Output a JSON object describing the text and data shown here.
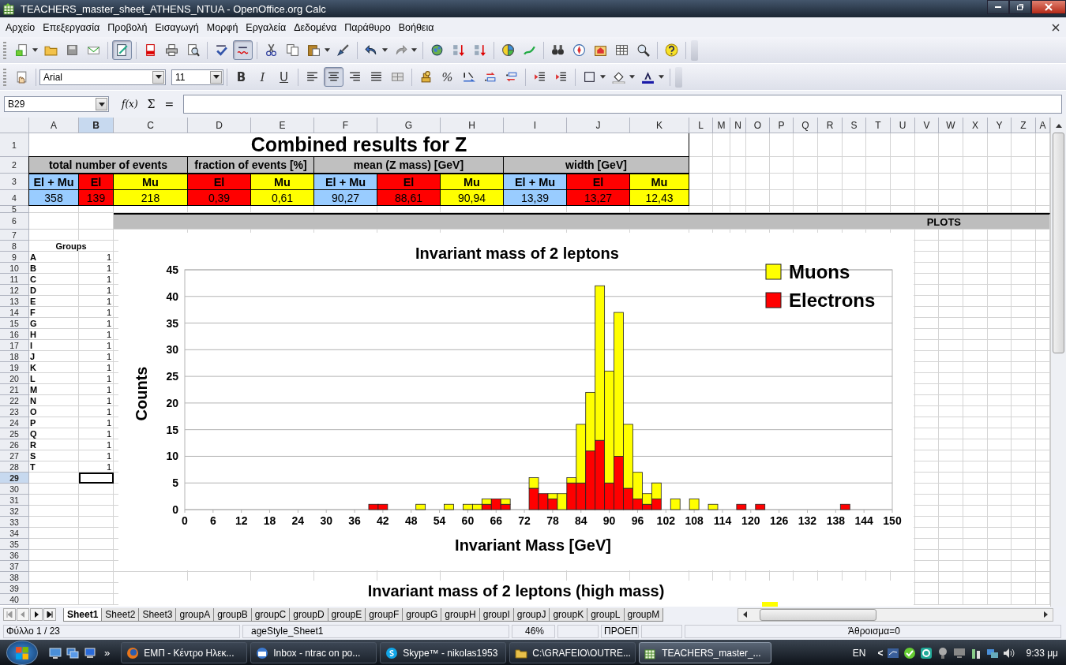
{
  "window": {
    "title": "TEACHERS_master_sheet_ATHENS_NTUA - OpenOffice.org Calc"
  },
  "menu": [
    "Αρχείο",
    "Επεξεργασία",
    "Προβολή",
    "Εισαγωγή",
    "Μορφή",
    "Εργαλεία",
    "Δεδομένα",
    "Παράθυρο",
    "Βοήθεια"
  ],
  "standard_toolbar": [
    [
      {
        "pressed": false
      },
      {
        "pressed": false
      },
      {
        "pressed": false
      },
      {
        "pressed": false
      }
    ],
    [
      {
        "pressed": true
      }
    ],
    [
      {
        "pressed": false
      },
      {
        "pressed": false
      },
      {
        "pressed": false
      }
    ],
    [
      {
        "pressed": false
      },
      {
        "pressed": true
      }
    ],
    [
      {
        "pressed": false
      },
      {
        "pressed": false
      },
      {
        "pressed": false
      },
      {
        "pressed": false
      }
    ],
    [
      {
        "pressed": false
      },
      {
        "pressed": false
      }
    ],
    [
      {
        "pressed": false
      },
      {
        "pressed": false
      },
      {
        "pressed": false
      }
    ],
    [
      {
        "pressed": false
      },
      {
        "pressed": false
      }
    ],
    [
      {
        "pressed": false
      },
      {
        "pressed": false
      },
      {
        "pressed": false
      },
      {
        "pressed": false
      },
      {
        "pressed": false
      }
    ],
    [
      {
        "pressed": false
      }
    ]
  ],
  "formatting_toolbar": {
    "font": "Arial",
    "size": "11",
    "groups": [
      [
        {
          "label": "B",
          "pressed": false
        },
        {
          "label": "I",
          "pressed": false
        },
        {
          "label": "U",
          "pressed": false
        }
      ],
      [
        {
          "pressed": false
        },
        {
          "pressed": true
        },
        {
          "pressed": false
        },
        {
          "pressed": false
        },
        {
          "pressed": false
        }
      ],
      [
        {
          "pressed": false
        },
        {
          "label": "%",
          "pressed": false
        },
        {
          "pressed": false
        },
        {
          "pressed": false
        },
        {
          "pressed": false
        }
      ],
      [
        {
          "pressed": false
        },
        {
          "pressed": false
        }
      ],
      [
        {
          "pressed": false
        },
        {
          "pressed": false
        },
        {
          "pressed": false
        }
      ]
    ]
  },
  "formula_bar": {
    "name_box": "B29",
    "function_wizard": "f(x)",
    "sum_button": "Σ",
    "equals_button": "="
  },
  "columns": [
    {
      "label": "A",
      "selected": false
    },
    {
      "label": "B",
      "selected": true
    },
    {
      "label": "C",
      "selected": false
    },
    {
      "label": "D",
      "selected": false
    },
    {
      "label": "E",
      "selected": false
    },
    {
      "label": "F",
      "selected": false
    },
    {
      "label": "G",
      "selected": false
    },
    {
      "label": "H",
      "selected": false
    },
    {
      "label": "I",
      "selected": false
    },
    {
      "label": "J",
      "selected": false
    },
    {
      "label": "K",
      "selected": false
    },
    {
      "label": "L",
      "selected": false
    },
    {
      "label": "M",
      "selected": false
    },
    {
      "label": "N",
      "selected": false
    },
    {
      "label": "O",
      "selected": false
    },
    {
      "label": "P",
      "selected": false
    },
    {
      "label": "Q",
      "selected": false
    },
    {
      "label": "R",
      "selected": false
    },
    {
      "label": "S",
      "selected": false
    },
    {
      "label": "T",
      "selected": false
    },
    {
      "label": "U",
      "selected": false
    },
    {
      "label": "V",
      "selected": false
    },
    {
      "label": "W",
      "selected": false
    },
    {
      "label": "X",
      "selected": false
    },
    {
      "label": "Y",
      "selected": false
    },
    {
      "label": "Z",
      "selected": false
    },
    {
      "label": "A",
      "selected": false
    }
  ],
  "rows": [
    {
      "label": "1",
      "selected": false
    },
    {
      "label": "2",
      "selected": false
    },
    {
      "label": "3",
      "selected": false
    },
    {
      "label": "4",
      "selected": false
    },
    {
      "label": "5",
      "selected": false
    },
    {
      "label": "6",
      "selected": false
    },
    {
      "label": "7",
      "selected": false
    },
    {
      "label": "8",
      "selected": false
    },
    {
      "label": "9",
      "selected": false
    },
    {
      "label": "10",
      "selected": false
    },
    {
      "label": "11",
      "selected": false
    },
    {
      "label": "12",
      "selected": false
    },
    {
      "label": "13",
      "selected": false
    },
    {
      "label": "14",
      "selected": false
    },
    {
      "label": "15",
      "selected": false
    },
    {
      "label": "16",
      "selected": false
    },
    {
      "label": "17",
      "selected": false
    },
    {
      "label": "18",
      "selected": false
    },
    {
      "label": "19",
      "selected": false
    },
    {
      "label": "20",
      "selected": false
    },
    {
      "label": "21",
      "selected": false
    },
    {
      "label": "22",
      "selected": false
    },
    {
      "label": "23",
      "selected": false
    },
    {
      "label": "24",
      "selected": false
    },
    {
      "label": "25",
      "selected": false
    },
    {
      "label": "26",
      "selected": false
    },
    {
      "label": "27",
      "selected": false
    },
    {
      "label": "28",
      "selected": false
    },
    {
      "label": "29",
      "selected": true
    },
    {
      "label": "30",
      "selected": false
    },
    {
      "label": "31",
      "selected": false
    },
    {
      "label": "32",
      "selected": false
    },
    {
      "label": "33",
      "selected": false
    },
    {
      "label": "34",
      "selected": false
    },
    {
      "label": "35",
      "selected": false
    },
    {
      "label": "36",
      "selected": false
    },
    {
      "label": "37",
      "selected": false
    },
    {
      "label": "38",
      "selected": false
    },
    {
      "label": "39",
      "selected": false
    },
    {
      "label": "40",
      "selected": false
    }
  ],
  "summary": {
    "title": "Combined results for Z",
    "groups": [
      {
        "label": "total number of events",
        "cells": [
          {
            "header": "El + Mu",
            "value": "358",
            "color": "#99ccff"
          },
          {
            "header": "El",
            "value": "139",
            "color": "#ff0000"
          },
          {
            "header": "Mu",
            "value": "218",
            "color": "#ffff00"
          }
        ]
      },
      {
        "label": "fraction of events [%]",
        "cells": [
          {
            "header": "El",
            "value": "0,39",
            "color": "#ff0000"
          },
          {
            "header": "Mu",
            "value": "0,61",
            "color": "#ffff00"
          }
        ]
      },
      {
        "label": "mean (Z mass) [GeV]",
        "cells": [
          {
            "header": "El + Mu",
            "value": "90,27",
            "color": "#99ccff"
          },
          {
            "header": "El",
            "value": "88,61",
            "color": "#ff0000"
          },
          {
            "header": "Mu",
            "value": "90,94",
            "color": "#ffff00"
          }
        ]
      },
      {
        "label": "width [GeV]",
        "cells": [
          {
            "header": "El + Mu",
            "value": "13,39",
            "color": "#99ccff"
          },
          {
            "header": "El",
            "value": "13,27",
            "color": "#ff0000"
          },
          {
            "header": "Mu",
            "value": "12,43",
            "color": "#ffff00"
          }
        ]
      }
    ]
  },
  "plots_header": "PLOTS",
  "groups_table": {
    "heading": "Groups",
    "rows": [
      {
        "group": "A",
        "value": "1"
      },
      {
        "group": "B",
        "value": "1"
      },
      {
        "group": "C",
        "value": "1"
      },
      {
        "group": "D",
        "value": "1"
      },
      {
        "group": "E",
        "value": "1"
      },
      {
        "group": "F",
        "value": "1"
      },
      {
        "group": "G",
        "value": "1"
      },
      {
        "group": "H",
        "value": "1"
      },
      {
        "group": "I",
        "value": "1"
      },
      {
        "group": "J",
        "value": "1"
      },
      {
        "group": "K",
        "value": "1"
      },
      {
        "group": "L",
        "value": "1"
      },
      {
        "group": "M",
        "value": "1"
      },
      {
        "group": "N",
        "value": "1"
      },
      {
        "group": "O",
        "value": "1"
      },
      {
        "group": "P",
        "value": "1"
      },
      {
        "group": "Q",
        "value": "1"
      },
      {
        "group": "R",
        "value": "1"
      },
      {
        "group": "S",
        "value": "1"
      },
      {
        "group": "T",
        "value": "1"
      }
    ]
  },
  "chart": {
    "chart_data": {
      "type": "bar",
      "title": "Invariant mass of 2 leptons",
      "xlabel": "Invariant Mass [GeV]",
      "ylabel": "Counts",
      "stacked": true,
      "grid": true,
      "legend": true,
      "xlim": [
        0,
        150
      ],
      "ylim": [
        0,
        45
      ],
      "xticks": [
        0,
        6,
        12,
        18,
        24,
        30,
        36,
        42,
        48,
        54,
        60,
        66,
        72,
        78,
        84,
        90,
        96,
        102,
        108,
        114,
        120,
        126,
        132,
        138,
        144,
        150
      ],
      "yticks": [
        0,
        5,
        10,
        15,
        20,
        25,
        30,
        35,
        40,
        45
      ],
      "x": [
        40,
        42,
        50,
        56,
        60,
        62,
        64,
        66,
        68,
        74,
        76,
        78,
        80,
        82,
        84,
        86,
        88,
        90,
        92,
        94,
        96,
        98,
        100,
        104,
        108,
        112,
        118,
        122,
        140
      ],
      "series": [
        {
          "name": "Electrons",
          "color": "#ff0000",
          "values": [
            1,
            1,
            0,
            0,
            0,
            0,
            1,
            2,
            1,
            4,
            3,
            2,
            0,
            5,
            5,
            11,
            13,
            5,
            10,
            4,
            2,
            1,
            2,
            0,
            0,
            0,
            1,
            1,
            1
          ]
        },
        {
          "name": "Muons",
          "color": "#ffff00",
          "values": [
            0,
            0,
            1,
            1,
            1,
            1,
            1,
            0,
            1,
            2,
            0,
            1,
            3,
            1,
            11,
            11,
            29,
            21,
            27,
            12,
            5,
            2,
            3,
            2,
            2,
            1,
            0,
            0,
            0
          ]
        }
      ]
    }
  },
  "chart_2": {
    "title": "Invariant mass of 2 leptons (high mass)",
    "legend": [
      {
        "color": "#ffff00"
      }
    ]
  },
  "sheet_tabs": [
    {
      "label": "Sheet1",
      "selected": true
    },
    {
      "label": "Sheet2",
      "selected": false
    },
    {
      "label": "Sheet3",
      "selected": false
    },
    {
      "label": "groupA",
      "selected": false
    },
    {
      "label": "groupB",
      "selected": false
    },
    {
      "label": "groupC",
      "selected": false
    },
    {
      "label": "groupD",
      "selected": false
    },
    {
      "label": "groupE",
      "selected": false
    },
    {
      "label": "groupF",
      "selected": false
    },
    {
      "label": "groupG",
      "selected": false
    },
    {
      "label": "groupH",
      "selected": false
    },
    {
      "label": "groupI",
      "selected": false
    },
    {
      "label": "groupJ",
      "selected": false
    },
    {
      "label": "groupK",
      "selected": false
    },
    {
      "label": "groupL",
      "selected": false
    },
    {
      "label": "groupM",
      "selected": false
    }
  ],
  "status_bar": {
    "sheet": "Φύλλο 1 / 23",
    "page_style": "ageStyle_Sheet1",
    "zoom": "46%",
    "mode": "ΠΡΟΕΠ",
    "sum": "Άθροισμα=0"
  },
  "taskbar": {
    "overflow": "»",
    "tasks": [
      {
        "label": "ΕΜΠ - Κέντρο Ηλεκ...",
        "active": false
      },
      {
        "label": "Inbox - ntrac on po...",
        "active": false
      },
      {
        "label": "Skype™ - nikolas1953",
        "active": false
      },
      {
        "label": "C:\\GRAFEIO\\OUTRE...",
        "active": false
      },
      {
        "label": "TEACHERS_master_...",
        "active": true
      }
    ],
    "language": "EN",
    "tray_toggle": "<",
    "clock": "9:33 μμ"
  }
}
